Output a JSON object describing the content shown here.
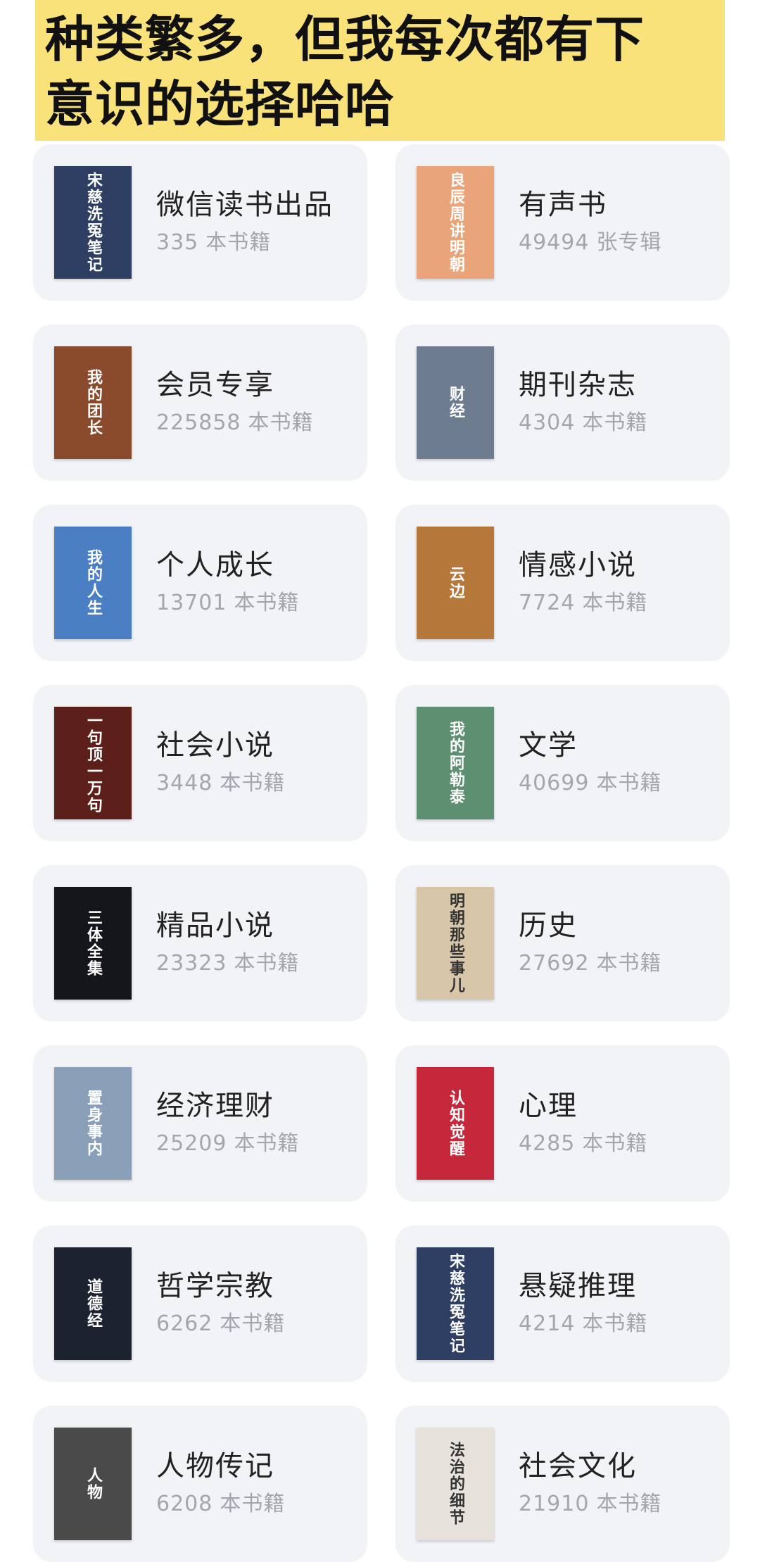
{
  "banner": {
    "line1": "种类繁多，但我每次都有下",
    "line2": "意识的选择哈哈"
  },
  "categories": [
    {
      "name": "微信读书出品",
      "count": "335",
      "unit": "本书籍",
      "cover_text": "宋慈洗冤笔记",
      "cover_color": "#2f3e63"
    },
    {
      "name": "有声书",
      "count": "49494",
      "unit": "张专辑",
      "cover_text": "良辰周讲明朝",
      "cover_color": "#e9a47a"
    },
    {
      "name": "会员专享",
      "count": "225858",
      "unit": "本书籍",
      "cover_text": "我的团长",
      "cover_color": "#8a4a2c"
    },
    {
      "name": "期刊杂志",
      "count": "4304",
      "unit": "本书籍",
      "cover_text": "财经",
      "cover_color": "#6d7c8f"
    },
    {
      "name": "个人成长",
      "count": "13701",
      "unit": "本书籍",
      "cover_text": "我的人生",
      "cover_color": "#4b7fc4"
    },
    {
      "name": "情感小说",
      "count": "7724",
      "unit": "本书籍",
      "cover_text": "云边",
      "cover_color": "#b5773a"
    },
    {
      "name": "社会小说",
      "count": "3448",
      "unit": "本书籍",
      "cover_text": "一句顶一万句",
      "cover_color": "#5c1f1a"
    },
    {
      "name": "文学",
      "count": "40699",
      "unit": "本书籍",
      "cover_text": "我的阿勒泰",
      "cover_color": "#5d9070"
    },
    {
      "name": "精品小说",
      "count": "23323",
      "unit": "本书籍",
      "cover_text": "三体全集",
      "cover_color": "#14161c"
    },
    {
      "name": "历史",
      "count": "27692",
      "unit": "本书籍",
      "cover_text": "明朝那些事儿",
      "cover_color": "#d8c6a8"
    },
    {
      "name": "经济理财",
      "count": "25209",
      "unit": "本书籍",
      "cover_text": "置身事内",
      "cover_color": "#8aa0b8"
    },
    {
      "name": "心理",
      "count": "4285",
      "unit": "本书籍",
      "cover_text": "认知觉醒",
      "cover_color": "#c4283a"
    },
    {
      "name": "哲学宗教",
      "count": "6262",
      "unit": "本书籍",
      "cover_text": "道德经",
      "cover_color": "#1d2230"
    },
    {
      "name": "悬疑推理",
      "count": "4214",
      "unit": "本书籍",
      "cover_text": "宋慈洗冤笔记",
      "cover_color": "#2f3e63"
    },
    {
      "name": "人物传记",
      "count": "6208",
      "unit": "本书籍",
      "cover_text": "人物",
      "cover_color": "#4a4a4a"
    },
    {
      "name": "社会文化",
      "count": "21910",
      "unit": "本书籍",
      "cover_text": "法治的细节",
      "cover_color": "#e7e3dc"
    }
  ]
}
